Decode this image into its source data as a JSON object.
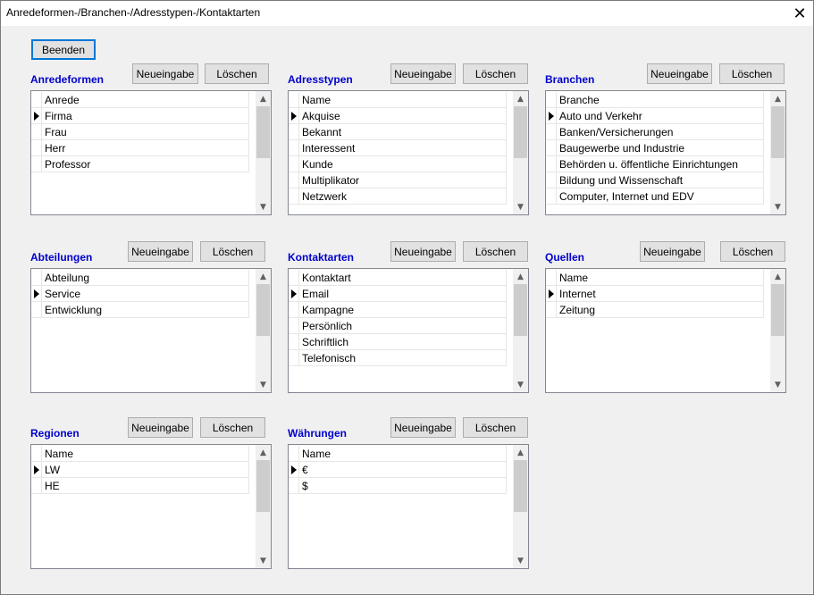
{
  "window": {
    "title": "Anredeformen-/Branchen-/Adresstypen-/Kontaktarten",
    "close_glyph": "✕"
  },
  "beenden_label": "Beenden",
  "panels": [
    {
      "id": "anredeformen",
      "label": "Anredeformen",
      "new_label": "Neueingabe",
      "delete_label": "Löschen",
      "column": "Anrede",
      "rows": [
        "Firma",
        "Frau",
        "Herr",
        "Professor"
      ],
      "selected": 0
    },
    {
      "id": "adresstypen",
      "label": "Adresstypen",
      "new_label": "Neueingabe",
      "delete_label": "Löschen",
      "column": "Name",
      "rows": [
        "Akquise",
        "Bekannt",
        "Interessent",
        "Kunde",
        "Multiplikator",
        "Netzwerk"
      ],
      "selected": 0
    },
    {
      "id": "branchen",
      "label": "Branchen",
      "new_label": "Neueingabe",
      "delete_label": "Löschen",
      "column": "Branche",
      "rows": [
        "Auto und Verkehr",
        "Banken/Versicherungen",
        "Baugewerbe und Industrie",
        "Behörden u. öffentliche Einrichtungen",
        "Bildung und Wissenschaft",
        "Computer, Internet und EDV"
      ],
      "selected": 0
    },
    {
      "id": "abteilungen",
      "label": "Abteilungen",
      "new_label": "Neueingabe",
      "delete_label": "Löschen",
      "column": "Abteilung",
      "rows": [
        "Service",
        "Entwicklung"
      ],
      "selected": 0
    },
    {
      "id": "kontaktarten",
      "label": "Kontaktarten",
      "new_label": "Neueingabe",
      "delete_label": "Löschen",
      "column": "Kontaktart",
      "rows": [
        "Email",
        "Kampagne",
        "Persönlich",
        "Schriftlich",
        "Telefonisch"
      ],
      "selected": 0
    },
    {
      "id": "quellen",
      "label": "Quellen",
      "new_label": "Neueingabe",
      "delete_label": "Löschen",
      "column": "Name",
      "rows": [
        "Internet",
        "Zeitung"
      ],
      "selected": 0
    },
    {
      "id": "regionen",
      "label": "Regionen",
      "new_label": "Neueingabe",
      "delete_label": "Löschen",
      "column": "Name",
      "rows": [
        "LW",
        "HE"
      ],
      "selected": 0
    },
    {
      "id": "waehrungen",
      "label": "Währungen",
      "new_label": "Neueingabe",
      "delete_label": "Löschen",
      "column": "Name",
      "rows": [
        "€",
        "$"
      ],
      "selected": 0
    }
  ]
}
